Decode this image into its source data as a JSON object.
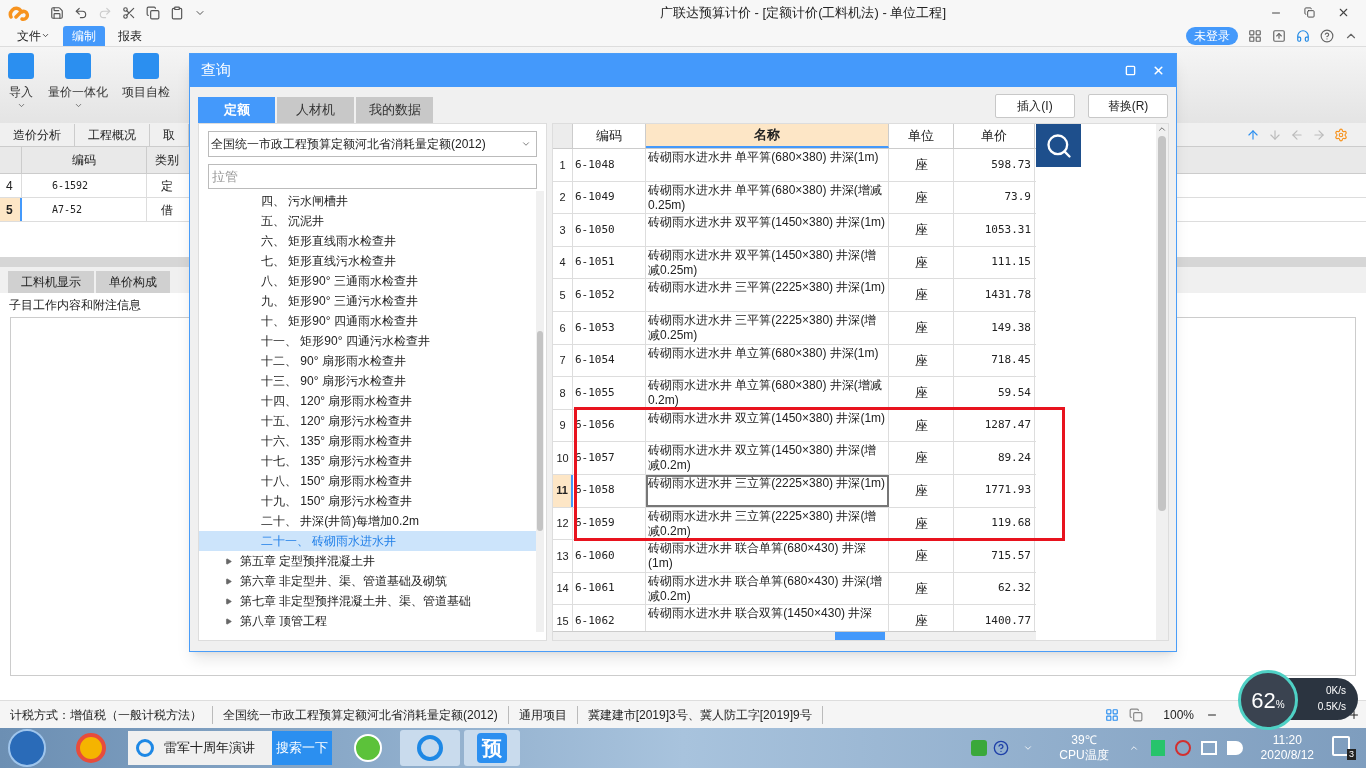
{
  "app": {
    "title": "广联达预算计价 - [定额计价(工料机法) - 单位工程]",
    "login": "未登录"
  },
  "menu": [
    {
      "label": "文件",
      "selected": false,
      "dropdown": true
    },
    {
      "label": "编制",
      "selected": true,
      "dropdown": false
    },
    {
      "label": "报表",
      "selected": false,
      "dropdown": false
    }
  ],
  "ribbon": [
    {
      "label": "导入",
      "dropdown": true
    },
    {
      "label": "量价一体化",
      "dropdown": true
    },
    {
      "label": "项目自检",
      "dropdown": false
    }
  ],
  "view_tabs": [
    "造价分析",
    "工程概况",
    "取"
  ],
  "grid": {
    "columns": [
      "编码",
      "类别"
    ],
    "rows": [
      {
        "num": "4",
        "code": "6-1592",
        "type": "定",
        "selected": false
      },
      {
        "num": "5",
        "code": "A7-52",
        "type": "借",
        "selected": true
      }
    ]
  },
  "detail_tabs": [
    "工料机显示",
    "单价构成"
  ],
  "detail_title": "子目工作内容和附注信息",
  "dialog": {
    "title": "查询",
    "tabs": [
      {
        "label": "定额",
        "selected": true
      },
      {
        "label": "人材机",
        "selected": false
      },
      {
        "label": "我的数据",
        "selected": false
      }
    ],
    "buttons": [
      "插入(I)",
      "替换(R)"
    ],
    "library": "全国统一市政工程预算定额河北省消耗量定额(2012)",
    "search": {
      "placeholder": "拉管"
    },
    "tree": {
      "sections": [
        {
          "label": "四、 污水闸槽井",
          "selected": false
        },
        {
          "label": "五、 沉泥井",
          "selected": false
        },
        {
          "label": "六、 矩形直线雨水检查井",
          "selected": false
        },
        {
          "label": "七、 矩形直线污水检查井",
          "selected": false
        },
        {
          "label": "八、 矩形90° 三通雨水检查井",
          "selected": false
        },
        {
          "label": "九、 矩形90° 三通污水检查井",
          "selected": false
        },
        {
          "label": "十、 矩形90° 四通雨水检查井",
          "selected": false
        },
        {
          "label": "十一、 矩形90° 四通污水检查井",
          "selected": false
        },
        {
          "label": "十二、 90° 扇形雨水检查井",
          "selected": false
        },
        {
          "label": "十三、 90° 扇形污水检查井",
          "selected": false
        },
        {
          "label": "十四、 120° 扇形雨水检查井",
          "selected": false
        },
        {
          "label": "十五、 120° 扇形污水检查井",
          "selected": false
        },
        {
          "label": "十六、 135° 扇形雨水检查井",
          "selected": false
        },
        {
          "label": "十七、 135° 扇形污水检查井",
          "selected": false
        },
        {
          "label": "十八、 150° 扇形雨水检查井",
          "selected": false
        },
        {
          "label": "十九、 150° 扇形污水检查井",
          "selected": false
        },
        {
          "label": "二十、 井深(井筒)每增加0.2m",
          "selected": false
        },
        {
          "label": "二十一、 砖砌雨水进水井",
          "selected": true
        }
      ],
      "chapters": [
        {
          "label": "第五章 定型预拌混凝土井",
          "expanded": false
        },
        {
          "label": "第六章 非定型井、渠、管道基础及砌筑",
          "expanded": false
        },
        {
          "label": "第七章 非定型预拌混凝土井、渠、管道基础",
          "expanded": false
        },
        {
          "label": "第八章 顶管工程",
          "expanded": false
        }
      ]
    },
    "table": {
      "columns": [
        "编码",
        "名称",
        "单位",
        "单价"
      ],
      "rows": [
        {
          "num": "1",
          "code": "6-1048",
          "name": "砖砌雨水进水井 单平箅(680×380) 井深(1m)",
          "unit": "座",
          "price": "598.73",
          "selected": false
        },
        {
          "num": "2",
          "code": "6-1049",
          "name": "砖砌雨水进水井 单平箅(680×380) 井深(增减0.25m)",
          "unit": "座",
          "price": "73.9",
          "selected": false
        },
        {
          "num": "3",
          "code": "6-1050",
          "name": "砖砌雨水进水井 双平箅(1450×380) 井深(1m)",
          "unit": "座",
          "price": "1053.31",
          "selected": false
        },
        {
          "num": "4",
          "code": "6-1051",
          "name": "砖砌雨水进水井 双平箅(1450×380) 井深(增减0.25m)",
          "unit": "座",
          "price": "111.15",
          "selected": false
        },
        {
          "num": "5",
          "code": "6-1052",
          "name": "砖砌雨水进水井 三平箅(2225×380) 井深(1m)",
          "unit": "座",
          "price": "1431.78",
          "selected": false
        },
        {
          "num": "6",
          "code": "6-1053",
          "name": "砖砌雨水进水井 三平箅(2225×380) 井深(增减0.25m)",
          "unit": "座",
          "price": "149.38",
          "selected": false
        },
        {
          "num": "7",
          "code": "6-1054",
          "name": "砖砌雨水进水井 单立箅(680×380) 井深(1m)",
          "unit": "座",
          "price": "718.45",
          "selected": false
        },
        {
          "num": "8",
          "code": "6-1055",
          "name": "砖砌雨水进水井 单立箅(680×380) 井深(增减0.2m)",
          "unit": "座",
          "price": "59.54",
          "selected": false
        },
        {
          "num": "9",
          "code": "6-1056",
          "name": "砖砌雨水进水井 双立箅(1450×380) 井深(1m)",
          "unit": "座",
          "price": "1287.47",
          "selected": false
        },
        {
          "num": "10",
          "code": "6-1057",
          "name": "砖砌雨水进水井 双立箅(1450×380) 井深(增减0.2m)",
          "unit": "座",
          "price": "89.24",
          "selected": false
        },
        {
          "num": "11",
          "code": "6-1058",
          "name": "砖砌雨水进水井 三立箅(2225×380) 井深(1m)",
          "unit": "座",
          "price": "1771.93",
          "selected": true
        },
        {
          "num": "12",
          "code": "6-1059",
          "name": "砖砌雨水进水井 三立箅(2225×380) 井深(增减0.2m)",
          "unit": "座",
          "price": "119.68",
          "selected": false
        },
        {
          "num": "13",
          "code": "6-1060",
          "name": "砖砌雨水进水井 联合单箅(680×430) 井深(1m)",
          "unit": "座",
          "price": "715.57",
          "selected": false
        },
        {
          "num": "14",
          "code": "6-1061",
          "name": "砖砌雨水进水井 联合单箅(680×430) 井深(增减0.2m)",
          "unit": "座",
          "price": "62.32",
          "selected": false
        },
        {
          "num": "15",
          "code": "6-1062",
          "name": "砖砌雨水进水井 联合双箅(1450×430) 井深",
          "unit": "座",
          "price": "1400.77",
          "selected": false
        }
      ]
    }
  },
  "status_bar": [
    "计税方式：增值税（一般计税方法）",
    "全国统一市政工程预算定额河北省消耗量定额(2012)",
    "通用项目",
    "冀建建市[2019]3号、冀人防工字[2019]9号"
  ],
  "zoom": "100%",
  "monitor": {
    "percent": "62",
    "unit": "%",
    "upload": "0K/s",
    "download": "0.5K/s"
  },
  "taskbar": {
    "search": "雷军十周年演讲",
    "search_button": "搜索一下",
    "app_label": "预",
    "temperature": "39℃",
    "temperature_label": "CPU温度",
    "time": "11:20",
    "date": "2020/8/12",
    "notifications": "3"
  }
}
